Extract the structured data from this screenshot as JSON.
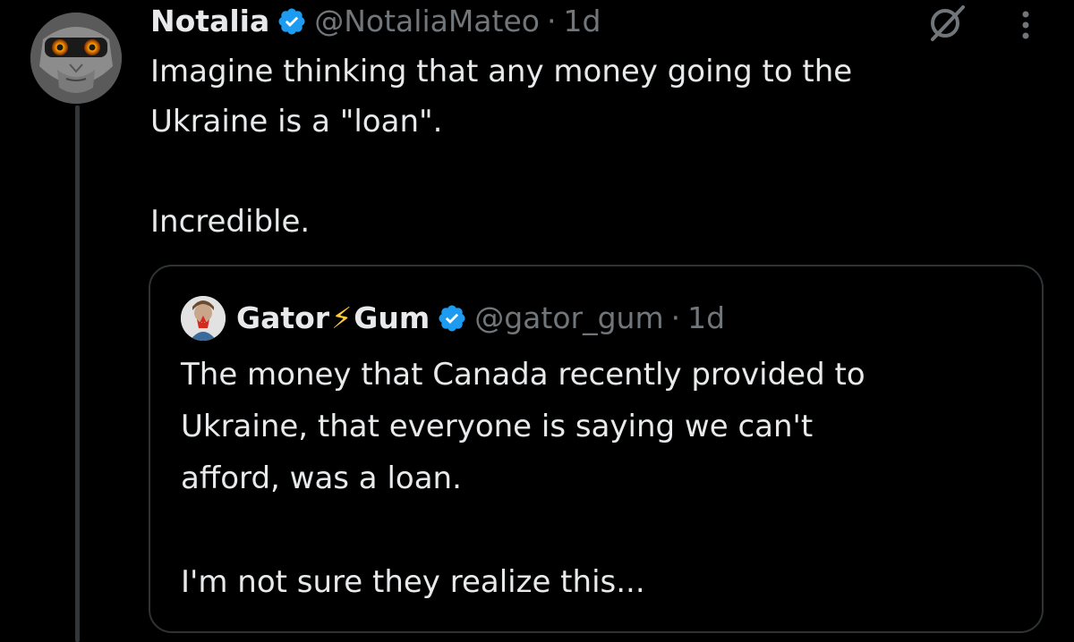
{
  "tweet": {
    "author": {
      "display_name": "Notalia",
      "handle": "@NotaliaMateo",
      "verified": true
    },
    "separator": "·",
    "time": "1d",
    "text_lines": [
      "Imagine thinking that any money going to the",
      "Ukraine is a \"loan\"."
    ],
    "text_line_2": "Incredible.",
    "icons": {
      "grok": "grok-icon",
      "more": "more-icon",
      "verified": "verified-badge-icon"
    }
  },
  "quote": {
    "author": {
      "name_part_1": "Gator",
      "name_emoji": "⚡",
      "name_part_2": "Gum",
      "handle": "@gator_gum",
      "verified": true
    },
    "separator": "·",
    "time": "1d",
    "text_lines": [
      "The money that Canada recently provided to",
      "Ukraine, that everyone is saying we can't",
      "afford, was a loan."
    ],
    "text_line_2": "I'm not sure they realize this..."
  },
  "colors": {
    "background": "#000000",
    "text_primary": "#e7e9ea",
    "text_secondary": "#71767b",
    "border": "#2f3336",
    "verified_blue": "#1d9bf0",
    "bolt_yellow": "#ffcc33"
  }
}
